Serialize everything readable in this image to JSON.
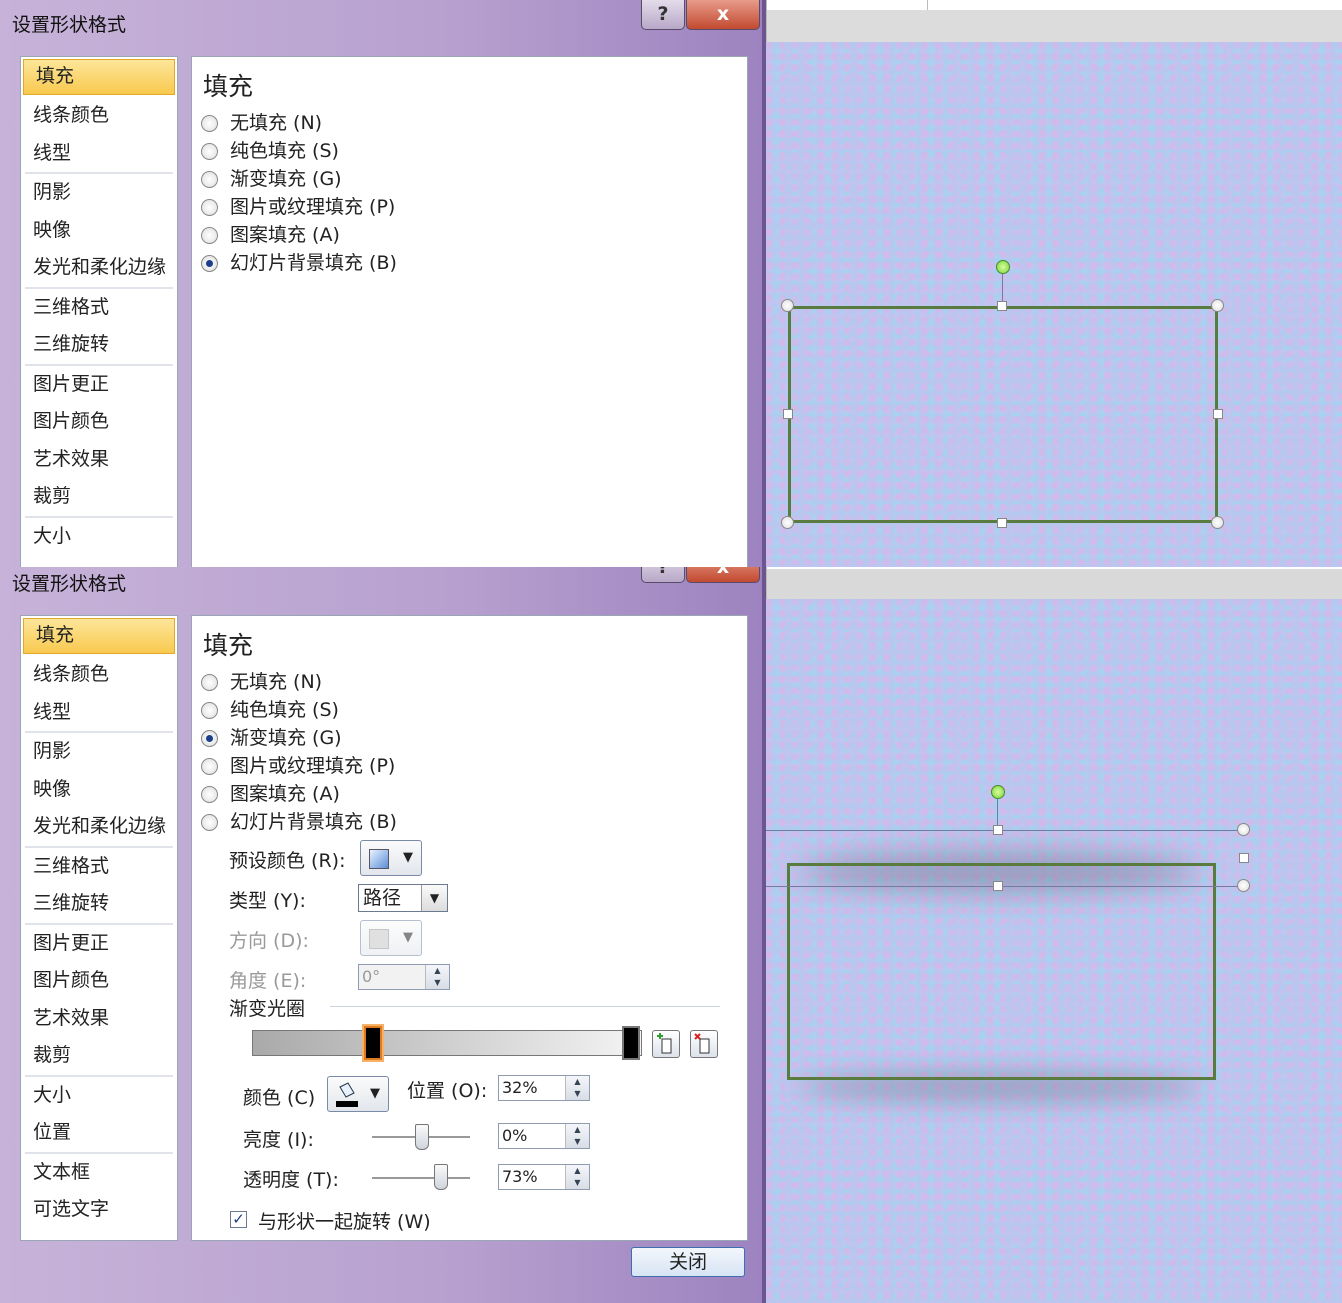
{
  "dialog": {
    "title": "设置形状格式",
    "help_label": "?",
    "close_x_label": "x",
    "close_button_label": "关闭"
  },
  "nav_top": [
    "填充",
    "线条颜色",
    "线型",
    "阴影",
    "映像",
    "发光和柔化边缘",
    "三维格式",
    "三维旋转",
    "图片更正",
    "图片颜色",
    "艺术效果",
    "裁剪",
    "大小"
  ],
  "nav_bottom": [
    "填充",
    "线条颜色",
    "线型",
    "阴影",
    "映像",
    "发光和柔化边缘",
    "三维格式",
    "三维旋转",
    "图片更正",
    "图片颜色",
    "艺术效果",
    "裁剪",
    "大小",
    "位置",
    "文本框",
    "可选文字"
  ],
  "fill": {
    "section_title": "填充",
    "options": [
      "无填充 (N)",
      "纯色填充 (S)",
      "渐变填充 (G)",
      "图片或纹理填充 (P)",
      "图案填充 (A)",
      "幻灯片背景填充 (B)"
    ],
    "top_selected": "幻灯片背景填充 (B)",
    "bottom_selected": "渐变填充 (G)"
  },
  "gradient": {
    "preset_label": "预设颜色 (R):",
    "type_label": "类型 (Y):",
    "type_value": "路径",
    "direction_label": "方向 (D):",
    "angle_label": "角度 (E):",
    "angle_value": "0°",
    "stops_label": "渐变光圈",
    "color_label": "颜色 (C)",
    "position_label": "位置 (O):",
    "position_value": "32%",
    "brightness_label": "亮度 (I):",
    "brightness_value": "0%",
    "transparency_label": "透明度 (T):",
    "transparency_value": "73%",
    "rotate_label": "与形状一起旋转 (W)",
    "rotate_checked": true
  },
  "icons": {
    "preset_swatch_color": "#5b8fd6",
    "direction_swatch_color": "#c8c8c8",
    "add_stop": "add-stop-icon",
    "remove_stop": "remove-stop-icon",
    "paint_bucket": "paint-bucket-icon"
  }
}
